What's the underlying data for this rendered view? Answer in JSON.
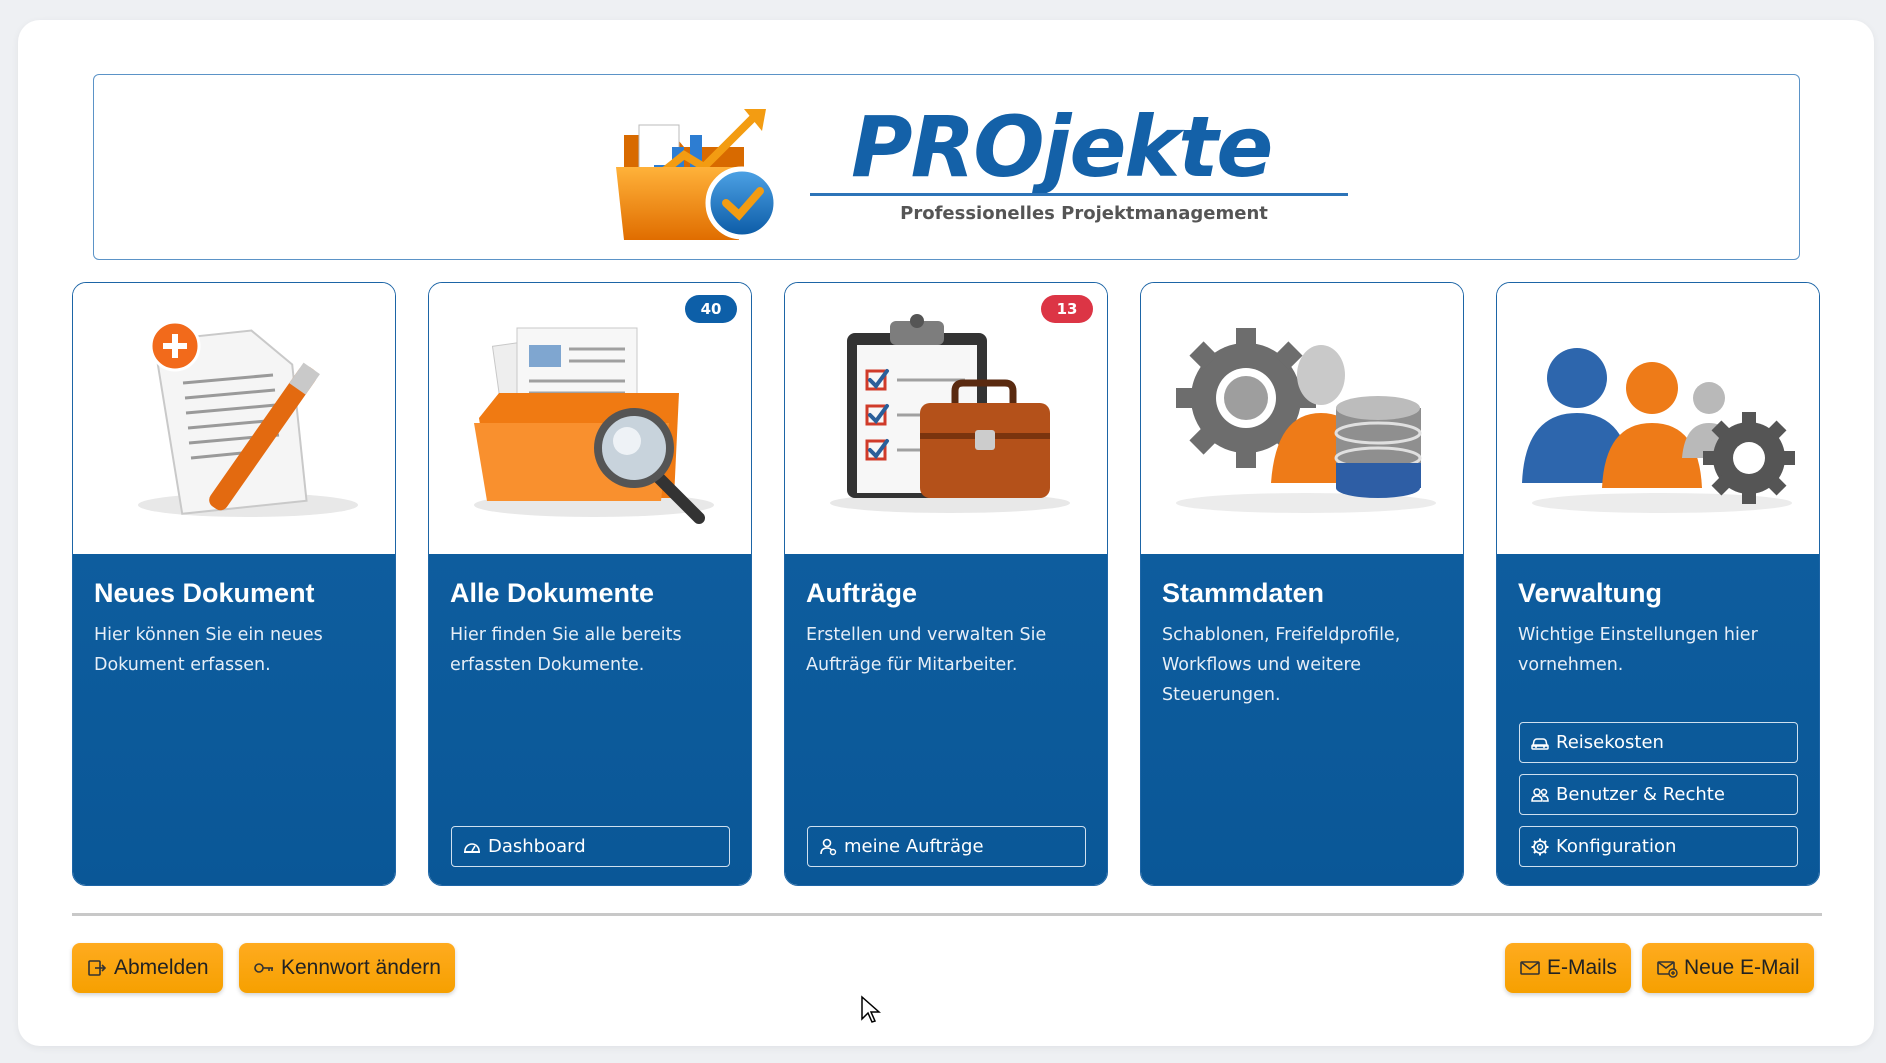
{
  "logo": {
    "title": "PROjekte",
    "subtitle": "Professionelles Projektmanagement"
  },
  "cards": [
    {
      "title": "Neues Dokument",
      "desc": "Hier können Sie ein neues Dokument erfassen.",
      "icon": "new-document-icon"
    },
    {
      "title": "Alle Dokumente",
      "desc": "Hier finden Sie alle bereits erfassten Dokumente.",
      "icon": "documents-folder-icon",
      "badge": "40",
      "badge_color": "#0d5fa8",
      "buttons": [
        {
          "label": "Dashboard",
          "icon": "dashboard-icon"
        }
      ]
    },
    {
      "title": "Aufträge",
      "desc": "Erstellen und verwalten Sie Aufträge für Mitarbeiter.",
      "icon": "clipboard-briefcase-icon",
      "badge": "13",
      "badge_color": "#dc3545",
      "buttons": [
        {
          "label": "meine Aufträge",
          "icon": "user-icon"
        }
      ]
    },
    {
      "title": "Stammdaten",
      "desc": "Schablonen, Freifeldprofile, Workflows und weitere Steuerungen.",
      "icon": "gear-database-icon"
    },
    {
      "title": "Verwaltung",
      "desc": "Wichtige Einstellungen hier vornehmen.",
      "icon": "users-gear-icon",
      "buttons": [
        {
          "label": "Reisekosten",
          "icon": "car-icon"
        },
        {
          "label": "Benutzer & Rechte",
          "icon": "users-icon"
        },
        {
          "label": "Konfiguration",
          "icon": "gear-icon"
        }
      ]
    }
  ],
  "footer": {
    "logout": "Abmelden",
    "change_password": "Kennwort ändern",
    "emails": "E-Mails",
    "new_email": "Neue E-Mail"
  },
  "colors": {
    "card_blue": "#0e5d9e",
    "orange": "#f6a000",
    "badge_blue": "#0d5fa8",
    "badge_red": "#dc3545"
  }
}
